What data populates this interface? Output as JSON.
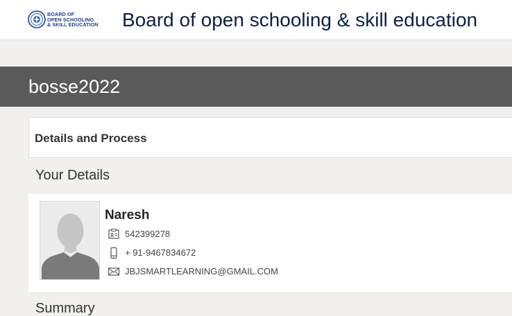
{
  "header": {
    "logo_lines": [
      "BOARD OF",
      "OPEN SCHOOLING",
      "& SKILL EDUCATION"
    ],
    "site_title": "Board of open schooling & skill education"
  },
  "banner": {
    "title": "bosse2022"
  },
  "details_card": {
    "title": "Details and Process"
  },
  "your_details": {
    "heading": "Your Details",
    "name": "Naresh",
    "id_number": "542399278",
    "phone": "+ 91-9467834672",
    "email": "JBJSMARTLEARNING@GMAIL.COM",
    "icons": [
      "id-card-icon",
      "mobile-phone-icon",
      "envelope-icon"
    ]
  },
  "summary": {
    "heading": "Summary"
  },
  "colors": {
    "banner": "#5a5a5a",
    "page_bg": "#f1f0ee",
    "title_text": "#0f1f45",
    "logo_blue": "#1d3f8f"
  }
}
